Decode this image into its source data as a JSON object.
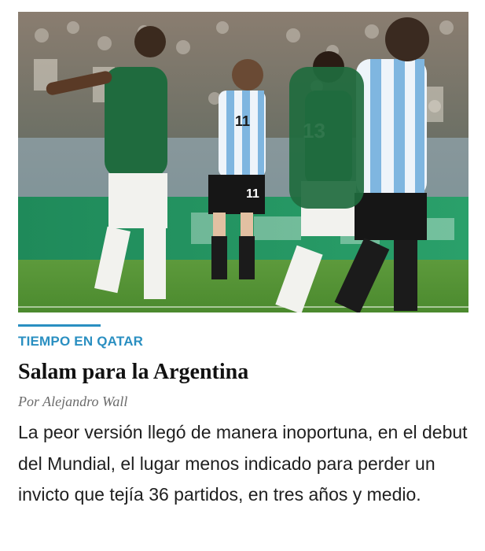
{
  "article": {
    "section": "TIEMPO EN QATAR",
    "headline": "Salam para la Argentina",
    "byline": "Por Alejandro Wall",
    "summary": "La peor versión llegó de manera inoportuna, en el debut del Mundial, el lugar menos indicado para perder un invicto que tejía 36 partidos, en tres años y medio."
  },
  "photo": {
    "jersey_numbers": [
      "11",
      "13"
    ]
  },
  "colors": {
    "accent": "#2a8fc1",
    "headline": "#111111",
    "byline": "#6b6b6b",
    "body": "#202020"
  }
}
